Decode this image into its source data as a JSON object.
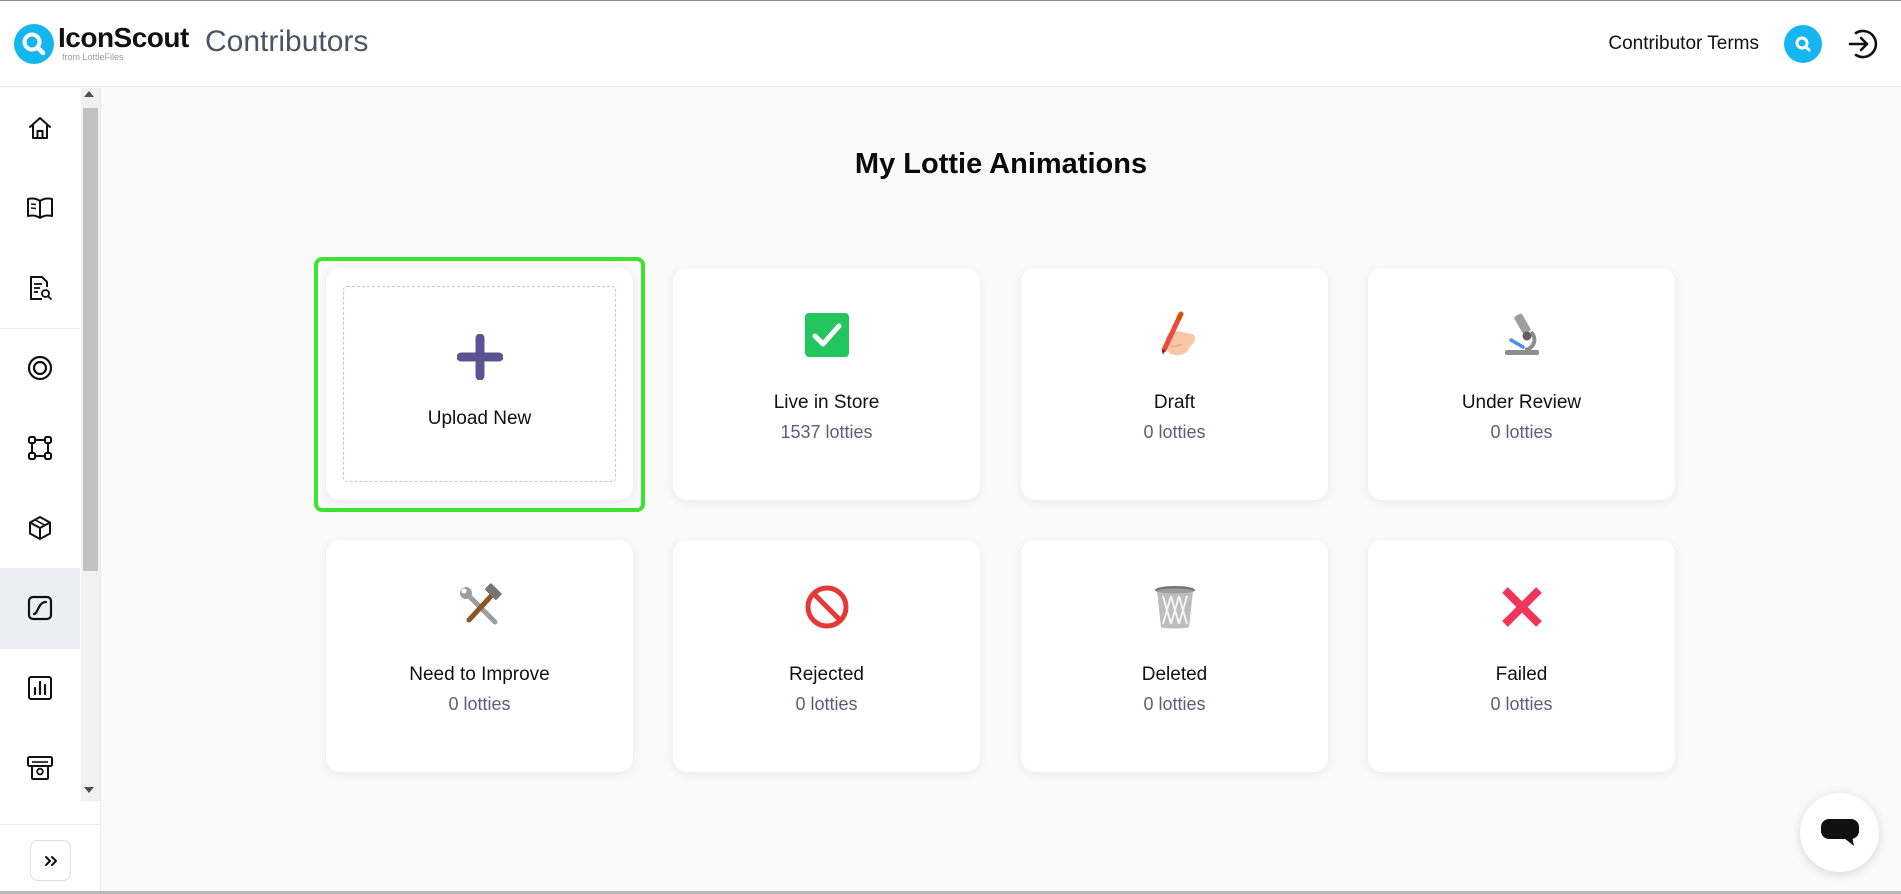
{
  "header": {
    "brand_name": "IconScout",
    "brand_sub": "from LottieFiles",
    "app_title": "Contributors",
    "terms_link": "Contributor Terms"
  },
  "sidebar": {
    "items": [
      {
        "icon": "home-icon"
      },
      {
        "icon": "book-icon"
      },
      {
        "icon": "document-search-icon"
      },
      {
        "icon": "target-icon"
      },
      {
        "icon": "vector-frame-icon"
      },
      {
        "icon": "cube-icon"
      },
      {
        "icon": "lottie-animation-icon",
        "active": true
      },
      {
        "icon": "bar-chart-icon"
      },
      {
        "icon": "payout-icon"
      }
    ]
  },
  "main": {
    "title": "My Lottie Animations",
    "upload_label": "Upload New",
    "cards": [
      {
        "label": "Live in Store",
        "count": "1537 lotties",
        "icon": "green-check-icon"
      },
      {
        "label": "Draft",
        "count": "0 lotties",
        "icon": "writing-hand-icon"
      },
      {
        "label": "Under Review",
        "count": "0 lotties",
        "icon": "microscope-icon"
      },
      {
        "label": "Need to Improve",
        "count": "0 lotties",
        "icon": "hammer-wrench-icon"
      },
      {
        "label": "Rejected",
        "count": "0 lotties",
        "icon": "prohibited-icon"
      },
      {
        "label": "Deleted",
        "count": "0 lotties",
        "icon": "trash-bin-icon"
      },
      {
        "label": "Failed",
        "count": "0 lotties",
        "icon": "red-cross-icon"
      }
    ]
  },
  "colors": {
    "brand": "#15b5f0",
    "highlight": "#3ee331",
    "plus": "#5b5491"
  }
}
